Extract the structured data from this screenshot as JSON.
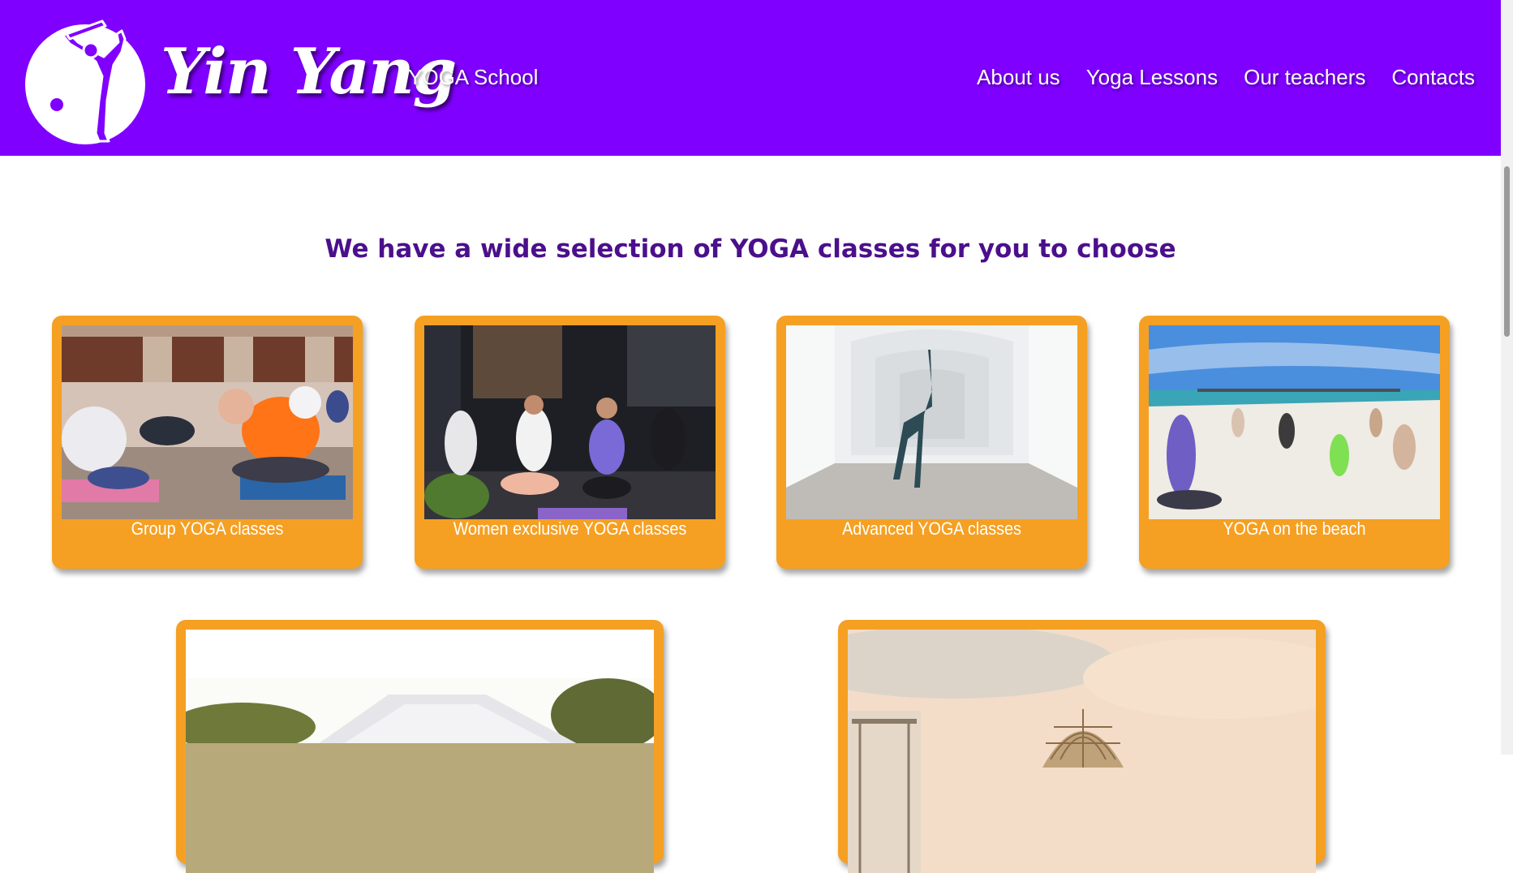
{
  "header": {
    "logo_text": "Yin Yang",
    "logo_subtitle": "YOGA School",
    "nav": [
      {
        "label": "About us"
      },
      {
        "label": "Yoga Lessons"
      },
      {
        "label": "Our teachers"
      },
      {
        "label": "Contacts"
      }
    ]
  },
  "main": {
    "headline": "We have a wide selection of YOGA classes for you to choose",
    "classes": [
      {
        "title": "Group YOGA classes",
        "image": "group-yoga-photo"
      },
      {
        "title": "Women exclusive YOGA classes",
        "image": "women-yoga-photo"
      },
      {
        "title": "Advanced YOGA classes",
        "image": "advanced-yoga-photo"
      },
      {
        "title": "YOGA on the beach",
        "image": "beach-yoga-photo"
      },
      {
        "title": "",
        "image": "tent-yoga-photo"
      },
      {
        "title": "",
        "image": "sunset-yoga-photo"
      }
    ]
  },
  "colors": {
    "header_bg": "#7f00ff",
    "card_bg": "#f5a023",
    "headline": "#4b0f8c",
    "nav_text": "#ffffff"
  }
}
